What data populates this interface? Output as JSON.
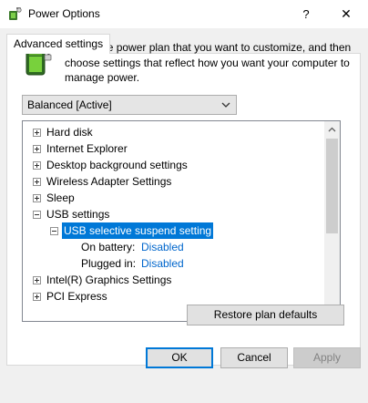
{
  "window": {
    "title": "Power Options",
    "help_glyph": "?",
    "close_glyph": "✕",
    "app_icon": "power-options-icon"
  },
  "tab": {
    "label": "Advanced settings"
  },
  "description": "Select the power plan that you want to customize, and then choose settings that reflect how you want your computer to manage power.",
  "plan_select": {
    "value": "Balanced [Active]"
  },
  "tree": {
    "items": [
      {
        "label": "Hard disk",
        "expander": "plus"
      },
      {
        "label": "Internet Explorer",
        "expander": "plus"
      },
      {
        "label": "Desktop background settings",
        "expander": "plus"
      },
      {
        "label": "Wireless Adapter Settings",
        "expander": "plus"
      },
      {
        "label": "Sleep",
        "expander": "plus"
      },
      {
        "label": "USB settings",
        "expander": "minus"
      },
      {
        "label": "USB selective suspend setting",
        "expander": "minus",
        "selected": true
      },
      {
        "label": "On battery:",
        "value": "Disabled"
      },
      {
        "label": "Plugged in:",
        "value": "Disabled"
      },
      {
        "label": "Intel(R) Graphics Settings",
        "expander": "plus"
      },
      {
        "label": "PCI Express",
        "expander": "plus"
      }
    ]
  },
  "buttons": {
    "restore": "Restore plan defaults",
    "ok": "OK",
    "cancel": "Cancel",
    "apply": "Apply"
  },
  "colors": {
    "selection": "#0078d7",
    "link": "#0066cc",
    "dialog_bg": "#f0f0f0"
  }
}
